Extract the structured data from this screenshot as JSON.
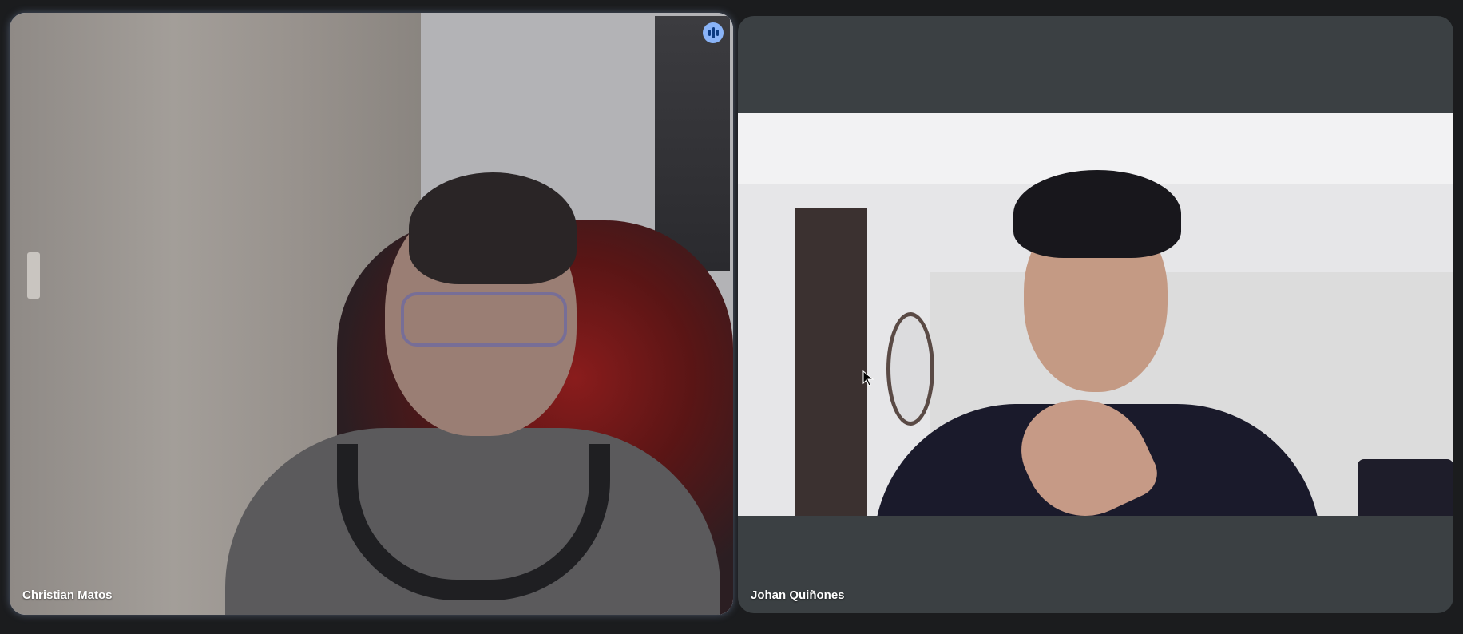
{
  "participants": [
    {
      "name": "Christian Matos",
      "speaking": true,
      "accent_color": "#a8c7fa"
    },
    {
      "name": "Johan Quiñones",
      "speaking": false
    }
  ],
  "icons": {
    "speaking_indicator": "audio-levels-icon",
    "cursor": "mouse-pointer-icon"
  },
  "colors": {
    "background": "#1b1c1e",
    "tile_background": "#3b4043",
    "active_speaker_border": "#a8c7fa"
  }
}
